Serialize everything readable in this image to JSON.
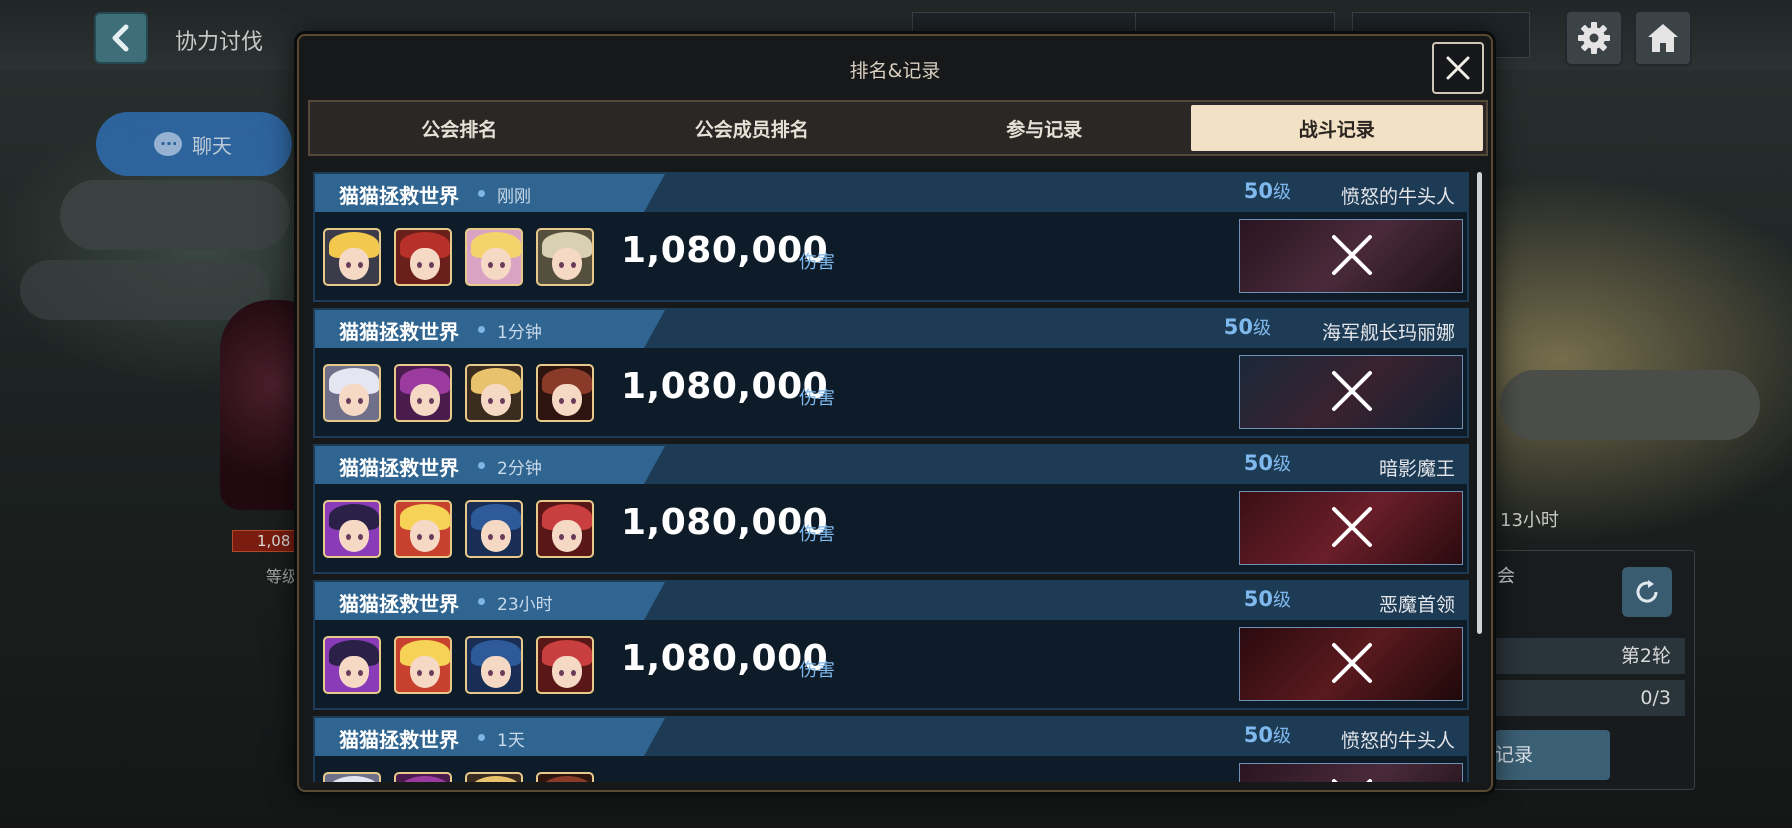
{
  "header": {
    "title": "协力讨伐"
  },
  "chat": {
    "label": "聊天"
  },
  "side_panel": {
    "timer_text": "13小时",
    "guild_text": "会",
    "round": "第2轮",
    "count": "0/3",
    "record_btn": "记录"
  },
  "bg": {
    "hp_text": "1,08",
    "level_text": "等级"
  },
  "modal": {
    "title": "排名&记录",
    "tabs": [
      {
        "label": "公会排名",
        "active": false
      },
      {
        "label": "公会成员排名",
        "active": false
      },
      {
        "label": "参与记录",
        "active": false
      },
      {
        "label": "战斗记录",
        "active": true
      }
    ],
    "entries": [
      {
        "guild": "猫猫拯救世界",
        "time": "刚刚",
        "level": "50",
        "level_unit": "级",
        "boss": "愤怒的牛头人",
        "damage": "1,080,000",
        "damage_label": "伤害",
        "heroes": [
          "blonde-knight",
          "red-maid",
          "blonde-mage",
          "silver-nun"
        ],
        "defeated": true
      },
      {
        "guild": "猫猫拯救世界",
        "time": "1分钟",
        "level": "50",
        "level_unit": "级",
        "boss": "海军舰长玛丽娜",
        "damage": "1,080,000",
        "damage_label": "伤害",
        "heroes": [
          "white-hair",
          "purple-maid",
          "blonde-hat",
          "brown-hair"
        ],
        "defeated": true
      },
      {
        "guild": "猫猫拯救世界",
        "time": "2分钟",
        "level": "50",
        "level_unit": "级",
        "boss": "暗影魔王",
        "damage": "1,080,000",
        "damage_label": "伤害",
        "heroes": [
          "dark-flower",
          "blonde-girl",
          "blue-witch",
          "red-elf"
        ],
        "defeated": true
      },
      {
        "guild": "猫猫拯救世界",
        "time": "23小时",
        "level": "50",
        "level_unit": "级",
        "boss": "恶魔首领",
        "damage": "1,080,000",
        "damage_label": "伤害",
        "heroes": [
          "dark-flower",
          "blonde-girl",
          "blue-witch",
          "red-elf"
        ],
        "defeated": true
      },
      {
        "guild": "猫猫拯救世界",
        "time": "1天",
        "level": "50",
        "level_unit": "级",
        "boss": "愤怒的牛头人",
        "damage": "",
        "damage_label": "",
        "heroes": [
          "white-hair",
          "purple-maid",
          "blonde-hat",
          "brown-hair"
        ],
        "defeated": true
      }
    ]
  },
  "colors": {
    "accent_blue": "#7fb8ec",
    "tab_active": "#f2e1c4",
    "hero_border": "#e7c98a"
  }
}
